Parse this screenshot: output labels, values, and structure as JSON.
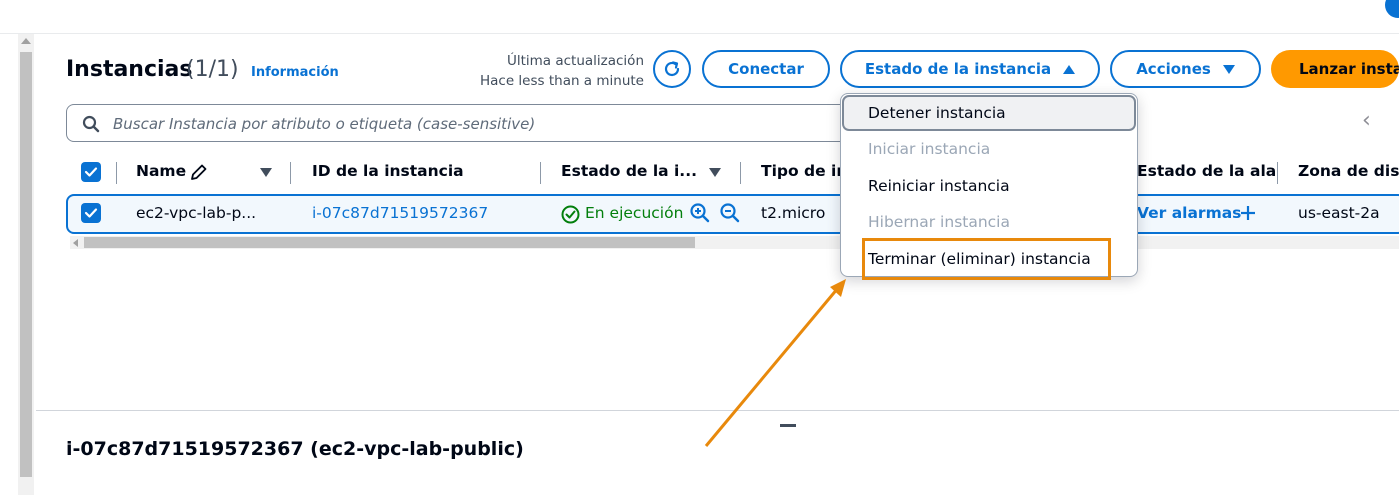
{
  "header": {
    "title": "Instancias",
    "count": "(1/1)",
    "info_link": "Información",
    "last_update_label": "Última actualización",
    "last_update_value": "Hace less than a minute"
  },
  "toolbar": {
    "connect": "Conectar",
    "instance_state": "Estado de la instancia",
    "actions": "Acciones",
    "launch": "Lanzar instancias"
  },
  "search": {
    "placeholder": "Buscar Instancia por atributo o etiqueta (case-sensitive)"
  },
  "table": {
    "columns": [
      "Name",
      "ID de la instancia",
      "Estado de la i...",
      "Tipo de in",
      "Estado de la ala",
      "Zona de disp"
    ],
    "row": {
      "name": "ec2-vpc-lab-p...",
      "id": "i-07c87d71519572367",
      "state": "En ejecución",
      "type": "t2.micro",
      "alarms": "Ver alarmas",
      "zone": "us-east-2a"
    }
  },
  "state_menu": {
    "items": [
      {
        "label": "Detener instancia",
        "enabled": true
      },
      {
        "label": "Iniciar instancia",
        "enabled": false
      },
      {
        "label": "Reiniciar instancia",
        "enabled": true
      },
      {
        "label": "Hibernar instancia",
        "enabled": false
      },
      {
        "label": "Terminar (eliminar) instancia",
        "enabled": true
      }
    ]
  },
  "detail": {
    "title": "i-07c87d71519572367 (ec2-vpc-lab-public)"
  },
  "colors": {
    "accent": "#0972d3",
    "primary": "#ff9900",
    "success": "#037f0c",
    "annotation": "#e8890c"
  }
}
